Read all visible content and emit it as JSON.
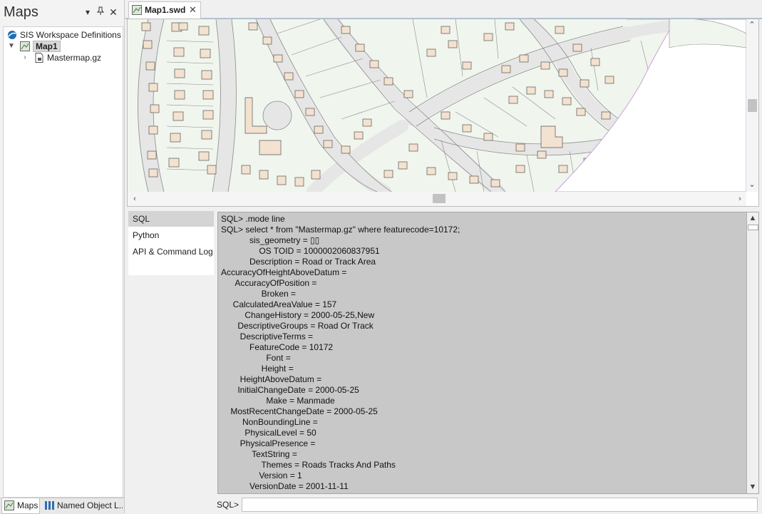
{
  "left_pane": {
    "title": "Maps",
    "tree": {
      "root_label": "SIS Workspace Definitions",
      "map_label": "Map1",
      "child_label": "Mastermap.gz"
    },
    "bottom_tabs": {
      "maps": "Maps",
      "named_objects": "Named Object L..."
    }
  },
  "document": {
    "tab_label": "Map1.swd"
  },
  "map": {
    "background": "#ffffff",
    "land_color": "#f0f5ee",
    "building_color": "#f3e2cf",
    "road_color": "#e6e6e6",
    "line_color": "#6e6e6e"
  },
  "console": {
    "tabs": [
      "SQL",
      "Python",
      "API & Command Log"
    ],
    "active_tab": "SQL",
    "lines": [
      "SQL> .mode line",
      "SQL> select * from \"Mastermap.gz\" where featurecode=10172;",
      "            sis_geometry = ▯▯",
      "                OS TOID = 1000002060837951",
      "            Description = Road or Track Area",
      "AccuracyOfHeightAboveDatum =",
      "      AccuracyOfPosition =",
      "                 Broken =",
      "     CalculatedAreaValue = 157",
      "          ChangeHistory = 2000-05-25,New",
      "       DescriptiveGroups = Road Or Track",
      "        DescriptiveTerms =",
      "            FeatureCode = 10172",
      "                   Font =",
      "                 Height =",
      "        HeightAboveDatum =",
      "       InitialChangeDate = 2000-05-25",
      "                   Make = Manmade",
      "    MostRecentChangeDate = 2000-05-25",
      "         NonBoundingLine =",
      "          PhysicalLevel = 50",
      "        PhysicalPresence =",
      "             TextString =",
      "                 Themes = Roads Tracks And Paths",
      "                Version = 1",
      "            VersionDate = 2001-11-11"
    ],
    "prompt": "SQL>",
    "input_value": ""
  }
}
